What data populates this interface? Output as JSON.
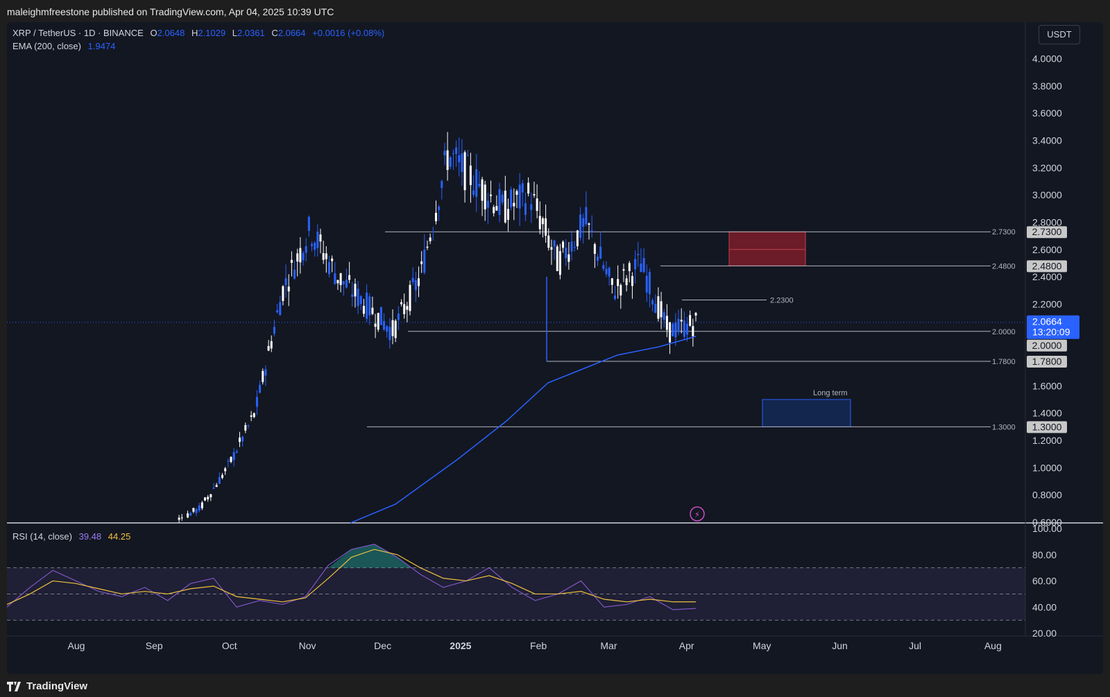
{
  "topbar": {
    "text": "maleighmfreestone published on TradingView.com, Apr 04, 2025 10:39 UTC"
  },
  "legend": {
    "symbol": "XRP / TetherUS · 1D · BINANCE",
    "o_label": "O",
    "o_value": "2.0648",
    "h_label": "H",
    "h_value": "2.1029",
    "l_label": "L",
    "l_value": "2.0361",
    "c_label": "C",
    "c_value": "2.0664",
    "change": "+0.0016 (+0.08%)",
    "ema_label": "EMA (200, close)",
    "ema_value": "1.9474",
    "rsi_label": "RSI (14, close)",
    "rsi_value": "39.48",
    "rsi_ma_value": "44.25"
  },
  "currency_button": "USDT",
  "price_axis": [
    "4.0000",
    "3.8000",
    "3.6000",
    "3.4000",
    "3.2000",
    "3.0000",
    "2.8000",
    "2.6000",
    "2.4000",
    "2.2000",
    "2.0000",
    "1.6000",
    "1.4000",
    "1.2000",
    "1.0000",
    "0.8000",
    "0.6000"
  ],
  "rsi_axis": [
    "100.00",
    "80.00",
    "60.00",
    "40.00",
    "20.00"
  ],
  "time_axis": [
    "Aug",
    "Sep",
    "Oct",
    "Nov",
    "Dec",
    "2025",
    "Feb",
    "Mar",
    "Apr",
    "May",
    "Jun",
    "Jul",
    "Aug"
  ],
  "levels": [
    {
      "label": "2.7300",
      "tag": "2.7300"
    },
    {
      "label": "2.4800",
      "tag": "2.4800"
    },
    {
      "label": "2.2300"
    },
    {
      "label": "2.0000",
      "tag": "2.0000"
    },
    {
      "label": "1.7800",
      "tag": "1.7800"
    },
    {
      "label": "1.3000",
      "tag": "1.3000"
    }
  ],
  "current_price": {
    "value": "2.0664",
    "countdown": "13:20:09"
  },
  "long_term_label": "Long term",
  "footer": {
    "brand": "TradingView"
  },
  "colors": {
    "up": "#2962ff",
    "down": "#ffffff",
    "ema": "#2962ff",
    "rsi": "#7e57c2",
    "rsi_ma": "#f0c23b",
    "resistance_zone": "#8b1e2b",
    "support_zone": "#14306a"
  },
  "chart_data": [
    {
      "type": "candlestick",
      "title": "XRP / TetherUS · 1D · BINANCE",
      "ylim": [
        0.6,
        4.0
      ],
      "x": [
        "2024-08",
        "2024-09",
        "2024-10",
        "2024-11",
        "2024-12",
        "2025-01",
        "2025-02",
        "2025-03",
        "2025-04",
        "2025-05",
        "2025-06",
        "2025-07",
        "2025-08"
      ],
      "series": [
        {
          "name": "EMA (200, close)",
          "last": 1.9474
        },
        {
          "name": "Close path",
          "values": [
            0.6,
            0.56,
            0.53,
            0.55,
            0.53,
            0.6,
            0.7,
            1.0,
            1.4,
            2.3,
            2.75,
            2.4,
            2.2,
            2.0,
            2.4,
            3.3,
            3.1,
            2.9,
            3.0,
            2.5,
            2.8,
            2.3,
            2.5,
            2.0,
            2.06
          ]
        }
      ],
      "horizontal_levels": [
        2.73,
        2.48,
        2.23,
        2.0,
        1.78,
        1.3
      ],
      "zones": [
        {
          "label": "",
          "from": 2.48,
          "to": 2.73
        },
        {
          "label": "Long term",
          "from": 1.3,
          "to": 1.5
        }
      ]
    },
    {
      "type": "line",
      "title": "RSI (14, close)",
      "ylim": [
        20,
        100
      ],
      "series": [
        {
          "name": "RSI",
          "values": [
            40,
            55,
            68,
            60,
            52,
            48,
            55,
            45,
            58,
            62,
            40,
            45,
            42,
            48,
            72,
            84,
            88,
            78,
            65,
            55,
            60,
            70,
            55,
            45,
            50,
            60,
            40,
            42,
            48,
            38,
            39
          ]
        },
        {
          "name": "RSI MA",
          "values": [
            42,
            50,
            60,
            58,
            54,
            50,
            52,
            50,
            54,
            56,
            48,
            46,
            44,
            47,
            62,
            78,
            84,
            80,
            70,
            62,
            60,
            64,
            58,
            50,
            50,
            52,
            46,
            44,
            46,
            44,
            44
          ]
        }
      ],
      "bands": [
        70,
        50,
        30
      ]
    }
  ]
}
